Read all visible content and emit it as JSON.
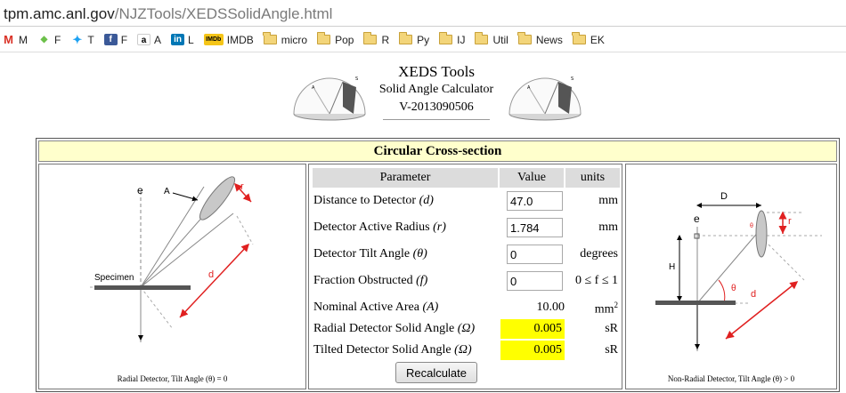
{
  "browser": {
    "url_host": "tpm.amc.anl.gov",
    "url_path": "/NJZTools/XEDSSolidAngle.html"
  },
  "bookmarks": [
    {
      "icon": "gmail-icon",
      "label": "M",
      "color": "#d93025",
      "glyph": "M"
    },
    {
      "icon": "feedly-icon",
      "label": "F",
      "color": "#6cc04a",
      "glyph": "◆"
    },
    {
      "icon": "twitter-icon",
      "label": "T",
      "color": "#1da1f2",
      "glyph": "✦"
    },
    {
      "icon": "facebook-icon",
      "label": "F",
      "color": "#3b5998",
      "glyph": "f"
    },
    {
      "icon": "amazon-icon",
      "label": "A",
      "color": "#ffffff",
      "glyph": "a"
    },
    {
      "icon": "linkedin-icon",
      "label": "L",
      "color": "#0077b5",
      "glyph": "in"
    },
    {
      "icon": "imdb-icon",
      "label": "IMDB",
      "color": "#f5c518",
      "glyph": "IMDb"
    },
    {
      "icon": "folder-icon",
      "label": "micro"
    },
    {
      "icon": "folder-icon",
      "label": "Pop"
    },
    {
      "icon": "folder-icon",
      "label": "R"
    },
    {
      "icon": "folder-icon",
      "label": "Py"
    },
    {
      "icon": "folder-icon",
      "label": "IJ"
    },
    {
      "icon": "folder-icon",
      "label": "Util"
    },
    {
      "icon": "folder-icon",
      "label": "News"
    },
    {
      "icon": "folder-icon",
      "label": "EK"
    }
  ],
  "header": {
    "title": "XEDS Tools",
    "subtitle": "Solid Angle Calculator",
    "version": "V-2013090506"
  },
  "section_title": "Circular Cross-section",
  "left_diagram": {
    "caption": "Radial Detector, Tilt Angle (θ) = 0",
    "labels": {
      "electron": "e",
      "a": "A",
      "r": "r",
      "specimen": "Specimen",
      "d": "d"
    }
  },
  "right_diagram": {
    "caption": "Non-Radial Detector, Tilt Angle (θ) > 0",
    "labels": {
      "d_upper": "D",
      "electron": "e",
      "r": "r",
      "h": "H",
      "theta": "θ",
      "d": "d",
      "theta_small": "θ"
    }
  },
  "params": {
    "headers": {
      "parameter": "Parameter",
      "value": "Value",
      "units": "units"
    },
    "distance": {
      "label": "Distance to Detector",
      "sym": "(d)",
      "value": "47.0",
      "unit": "mm"
    },
    "radius": {
      "label": "Detector Active Radius",
      "sym": "(r)",
      "value": "1.784",
      "unit": "mm"
    },
    "tilt": {
      "label": "Detector Tilt Angle",
      "sym": "(θ)",
      "value": "0",
      "unit": "degrees"
    },
    "obstructed": {
      "label": "Fraction Obstructed",
      "sym": "(f)",
      "value": "0",
      "unit": "0 ≤ f ≤ 1"
    },
    "nominal": {
      "label": "Nominal Active Area",
      "sym": "(A)",
      "value": "10.00",
      "unit": "mm",
      "unit_sup": "2"
    },
    "radial": {
      "label": "Radial Detector Solid Angle",
      "sym": "(Ω)",
      "value": "0.005",
      "unit": "sR"
    },
    "tilted": {
      "label": "Tilted Detector Solid Angle",
      "sym": "(Ω)",
      "value": "0.005",
      "unit": "sR"
    },
    "button": "Recalculate"
  },
  "colors": {
    "section_bg": "#ffffcc",
    "result_bg": "#ffff00",
    "arrow_red": "#e02020",
    "detector_gray": "#c8c8c8"
  }
}
